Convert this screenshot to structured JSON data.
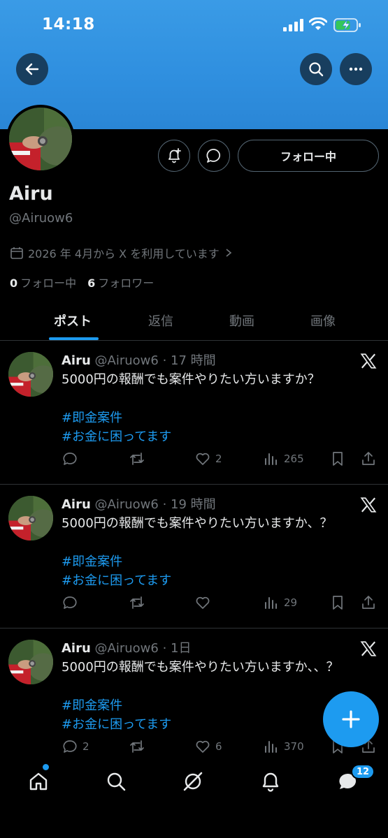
{
  "status_bar": {
    "time": "14:18"
  },
  "profile": {
    "name": "Airu",
    "handle": "@Airuow6",
    "joined": "2026 年 4月から X を利用しています",
    "following_count": "0",
    "following_label": "フォロー中",
    "followers_count": "6",
    "followers_label": "フォロワー",
    "follow_button_label": "フォロー中"
  },
  "tabs": [
    {
      "label": "ポスト",
      "active": true
    },
    {
      "label": "返信",
      "active": false
    },
    {
      "label": "動画",
      "active": false
    },
    {
      "label": "画像",
      "active": false
    }
  ],
  "tweets": [
    {
      "name": "Airu",
      "meta": "@Airuow6 · 17 時間",
      "text": "5000円の報酬でも案件やりたい方いますか？",
      "hashtags": [
        "#即金案件",
        "#お金に困ってます"
      ],
      "replies": "",
      "retweets": "",
      "likes": "2",
      "views": "265"
    },
    {
      "name": "Airu",
      "meta": "@Airuow6 · 19 時間",
      "text": "5000円の報酬でも案件やりたい方いますか、？",
      "hashtags": [
        "#即金案件",
        "#お金に困ってます"
      ],
      "replies": "",
      "retweets": "",
      "likes": "",
      "views": "29"
    },
    {
      "name": "Airu",
      "meta": "@Airuow6 · 1日",
      "text": "5000円の報酬でも案件やりたい方いますか、、？",
      "hashtags": [
        "#即金案件",
        "#お金に困ってます"
      ],
      "replies": "2",
      "retweets": "",
      "likes": "6",
      "views": "370"
    }
  ],
  "bottom_nav": {
    "items": [
      "home-icon",
      "search-icon",
      "grok-icon",
      "bell-icon",
      "messages-icon"
    ],
    "messages_badge": "12"
  },
  "colors": {
    "accent": "#1d9bf0",
    "banner": "#2f8fdf",
    "background": "#000000",
    "text_primary": "#e7e9ea",
    "text_secondary": "#71767b",
    "divider": "#2f3336"
  }
}
